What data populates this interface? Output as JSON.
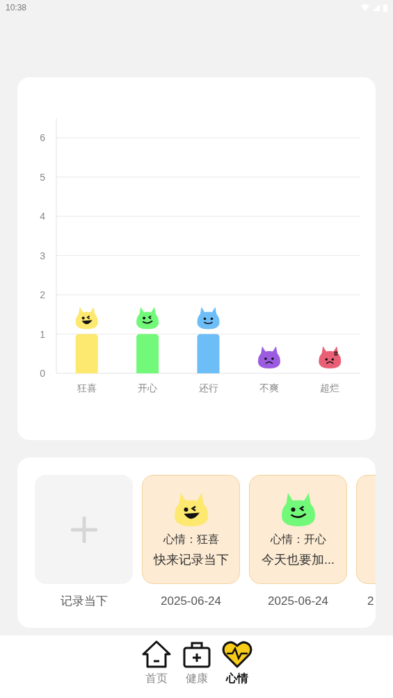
{
  "status_bar": {
    "time": "10:38"
  },
  "chart": {
    "chart_data": {
      "type": "bar",
      "categories": [
        "狂喜",
        "开心",
        "还行",
        "不爽",
        "超烂"
      ],
      "values": [
        1,
        1,
        1,
        0,
        0
      ],
      "ylim": [
        0,
        6.5
      ],
      "yticks": [
        0,
        1,
        2,
        3,
        4,
        5,
        6
      ],
      "grid": true
    },
    "faces": [
      {
        "kind": "grin",
        "color": "#fde870"
      },
      {
        "kind": "wink",
        "color": "#72f97a"
      },
      {
        "kind": "smile",
        "color": "#6dbdf7"
      },
      {
        "kind": "frown",
        "color": "#9b5ce0"
      },
      {
        "kind": "angry",
        "color": "#e95f75"
      }
    ]
  },
  "records": [
    {
      "kind": "add",
      "caption": "记录当下"
    },
    {
      "kind": "entry",
      "face": {
        "kind": "grin",
        "color": "#fde870"
      },
      "mood": "心情：狂喜",
      "note": "快来记录当下",
      "date": "2025-06-24"
    },
    {
      "kind": "entry",
      "face": {
        "kind": "wink",
        "color": "#72f97a"
      },
      "mood": "心情：开心",
      "note": "今天也要加...",
      "date": "2025-06-24"
    },
    {
      "kind": "entry",
      "date": "2"
    }
  ],
  "nav": [
    {
      "label": "首页",
      "selected": false
    },
    {
      "label": "健康",
      "selected": false
    },
    {
      "label": "心情",
      "selected": true
    }
  ]
}
